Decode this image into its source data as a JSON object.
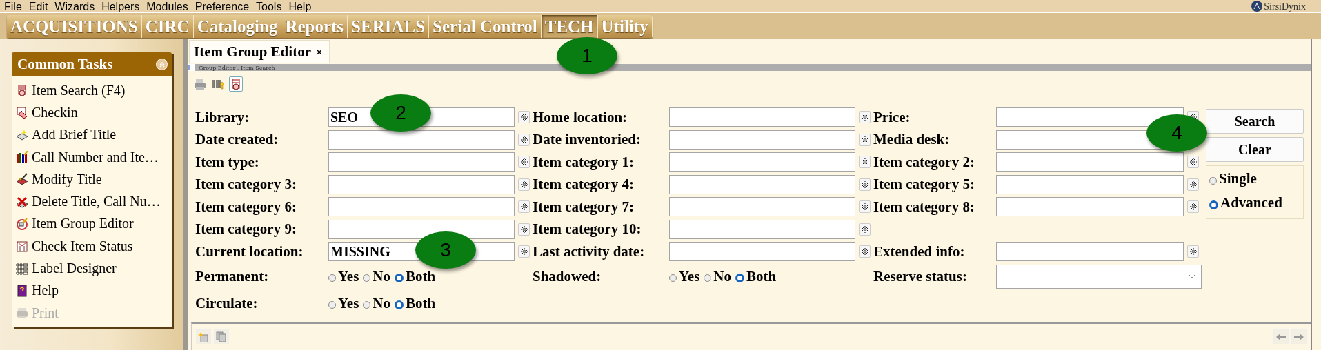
{
  "menu_bar": {
    "items": [
      "File",
      "Edit",
      "Wizards",
      "Helpers",
      "Modules",
      "Preference",
      "Tools",
      "Help"
    ],
    "brand": "SirsiDynix"
  },
  "module_tabs": [
    {
      "label": "ACQUISITIONS",
      "selected": false
    },
    {
      "label": "CIRC",
      "selected": false
    },
    {
      "label": "Cataloging",
      "selected": false
    },
    {
      "label": "Reports",
      "selected": false
    },
    {
      "label": "SERIALS",
      "selected": false
    },
    {
      "label": "Serial Control",
      "selected": false
    },
    {
      "label": "TECH",
      "selected": true
    },
    {
      "label": "Utility",
      "selected": false
    }
  ],
  "sidebar": {
    "title": "Common Tasks",
    "items": [
      {
        "label": "Item Search (F4)",
        "disabled": false
      },
      {
        "label": "Checkin",
        "disabled": false
      },
      {
        "label": "Add Brief Title",
        "disabled": false
      },
      {
        "label": "Call Number and Ite…",
        "disabled": false
      },
      {
        "label": "Modify Title",
        "disabled": false
      },
      {
        "label": "Delete Title, Call Nu…",
        "disabled": false
      },
      {
        "label": "Item Group Editor",
        "disabled": false
      },
      {
        "label": "Check Item Status",
        "disabled": false
      },
      {
        "label": "Label Designer",
        "disabled": false
      },
      {
        "label": "Help",
        "disabled": false
      },
      {
        "label": "Print",
        "disabled": true
      }
    ]
  },
  "editor": {
    "tab": {
      "title": "Item Group Editor",
      "close": "×"
    },
    "breadcrumb": "Group Editor : Item Search",
    "toolbar": [
      {
        "selected": false
      },
      {
        "selected": false
      },
      {
        "selected": true
      }
    ],
    "form": {
      "rows": [
        [
          {
            "kind": "text",
            "label": "Library:",
            "value": "SEO"
          },
          {
            "kind": "text",
            "label": "Home location:"
          },
          {
            "kind": "text",
            "label": "Price:"
          }
        ],
        [
          {
            "kind": "text",
            "label": "Date created:"
          },
          {
            "kind": "text",
            "label": "Date inventoried:"
          },
          {
            "kind": "text",
            "label": "Media desk:"
          }
        ],
        [
          {
            "kind": "text",
            "label": "Item type:"
          },
          {
            "kind": "text",
            "label": "Item category 1:"
          },
          {
            "kind": "text",
            "label": "Item category 2:"
          }
        ],
        [
          {
            "kind": "text",
            "label": "Item category 3:"
          },
          {
            "kind": "text",
            "label": "Item category 4:"
          },
          {
            "kind": "text",
            "label": "Item category 5:"
          }
        ],
        [
          {
            "kind": "text",
            "label": "Item category 6:"
          },
          {
            "kind": "text",
            "label": "Item category 7:"
          },
          {
            "kind": "text",
            "label": "Item category 8:"
          }
        ],
        [
          {
            "kind": "text",
            "label": "Item category 9:"
          },
          {
            "kind": "text",
            "label": "Item category 10:"
          }
        ],
        [
          {
            "kind": "text",
            "label": "Current location:",
            "value": "MISSING"
          },
          {
            "kind": "text",
            "label": "Last activity date:"
          },
          {
            "kind": "text",
            "label": "Extended info:"
          }
        ],
        [
          {
            "kind": "radio",
            "label": "Permanent:",
            "options": [
              {
                "label": "Yes",
                "selected": false
              },
              {
                "label": "No",
                "selected": false
              },
              {
                "label": "Both",
                "selected": true
              }
            ]
          },
          {
            "kind": "radio",
            "label": "Shadowed:",
            "options": [
              {
                "label": "Yes",
                "selected": false
              },
              {
                "label": "No",
                "selected": false
              },
              {
                "label": "Both",
                "selected": true
              }
            ]
          },
          {
            "kind": "select",
            "label": "Reserve status:"
          }
        ],
        [
          {
            "kind": "radio",
            "label": "Circulate:",
            "options": [
              {
                "label": "Yes",
                "selected": false
              },
              {
                "label": "No",
                "selected": false
              },
              {
                "label": "Both",
                "selected": true
              }
            ]
          }
        ]
      ]
    },
    "buttons": [
      "Search",
      "Clear"
    ],
    "mode": [
      {
        "label": "Single",
        "selected": false
      },
      {
        "label": "Advanced",
        "selected": true
      }
    ]
  },
  "callouts": [
    "1",
    "2",
    "3",
    "4"
  ]
}
